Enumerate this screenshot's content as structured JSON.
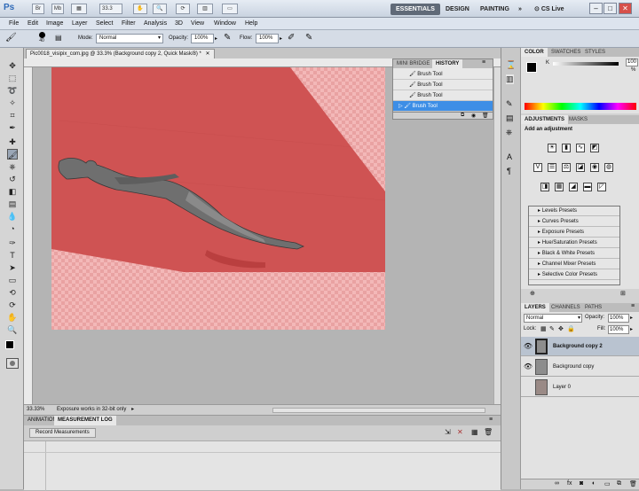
{
  "app": {
    "logo": "Ps"
  },
  "titlebar": {
    "zoom": "33.3",
    "workspaces": [
      "ESSENTIALS",
      "DESIGN",
      "PAINTING"
    ],
    "more": "»",
    "cslive": "CS Live"
  },
  "menubar": [
    "File",
    "Edit",
    "Image",
    "Layer",
    "Select",
    "Filter",
    "Analysis",
    "3D",
    "View",
    "Window",
    "Help"
  ],
  "options": {
    "brush_size": "40",
    "mode_label": "Mode:",
    "mode_value": "Normal",
    "opacity_label": "Opacity:",
    "opacity_value": "100%",
    "flow_label": "Flow:",
    "flow_value": "100%"
  },
  "document": {
    "tab_title": "Pic0018_visipix_com.jpg @ 33.3% (Background copy 2, Quick Mask/8) *",
    "zoom_status": "33.33%",
    "status_message": "Exposure works in 32-bit only"
  },
  "history": {
    "tabs": [
      "MINI BRIDGE",
      "HISTORY"
    ],
    "items": [
      "Brush Tool",
      "Brush Tool",
      "Brush Tool",
      "Brush Tool"
    ]
  },
  "bottom_panel": {
    "tabs": [
      "ANIMATION",
      "MEASUREMENT LOG"
    ],
    "record_button": "Record Measurements"
  },
  "color_panel": {
    "tabs": [
      "COLOR",
      "SWATCHES",
      "STYLES"
    ],
    "channel": "K",
    "value": "100",
    "unit": "%"
  },
  "adjustments": {
    "tabs": [
      "ADJUSTMENTS",
      "MASKS"
    ],
    "heading": "Add an adjustment",
    "presets": [
      "Levels Presets",
      "Curves Presets",
      "Exposure Presets",
      "Hue/Saturation Presets",
      "Black & White Presets",
      "Channel Mixer Presets",
      "Selective Color Presets"
    ]
  },
  "layers": {
    "tabs": [
      "LAYERS",
      "CHANNELS",
      "PATHS"
    ],
    "blend": "Normal",
    "opacity_label": "Opacity:",
    "opacity_value": "100%",
    "lock_label": "Lock:",
    "fill_label": "Fill:",
    "fill_value": "100%",
    "items": [
      "Background copy 2",
      "Background copy",
      "Layer 0"
    ]
  },
  "colors": {
    "mask_red": "#d45454",
    "active_row": "#3d8ee6"
  }
}
